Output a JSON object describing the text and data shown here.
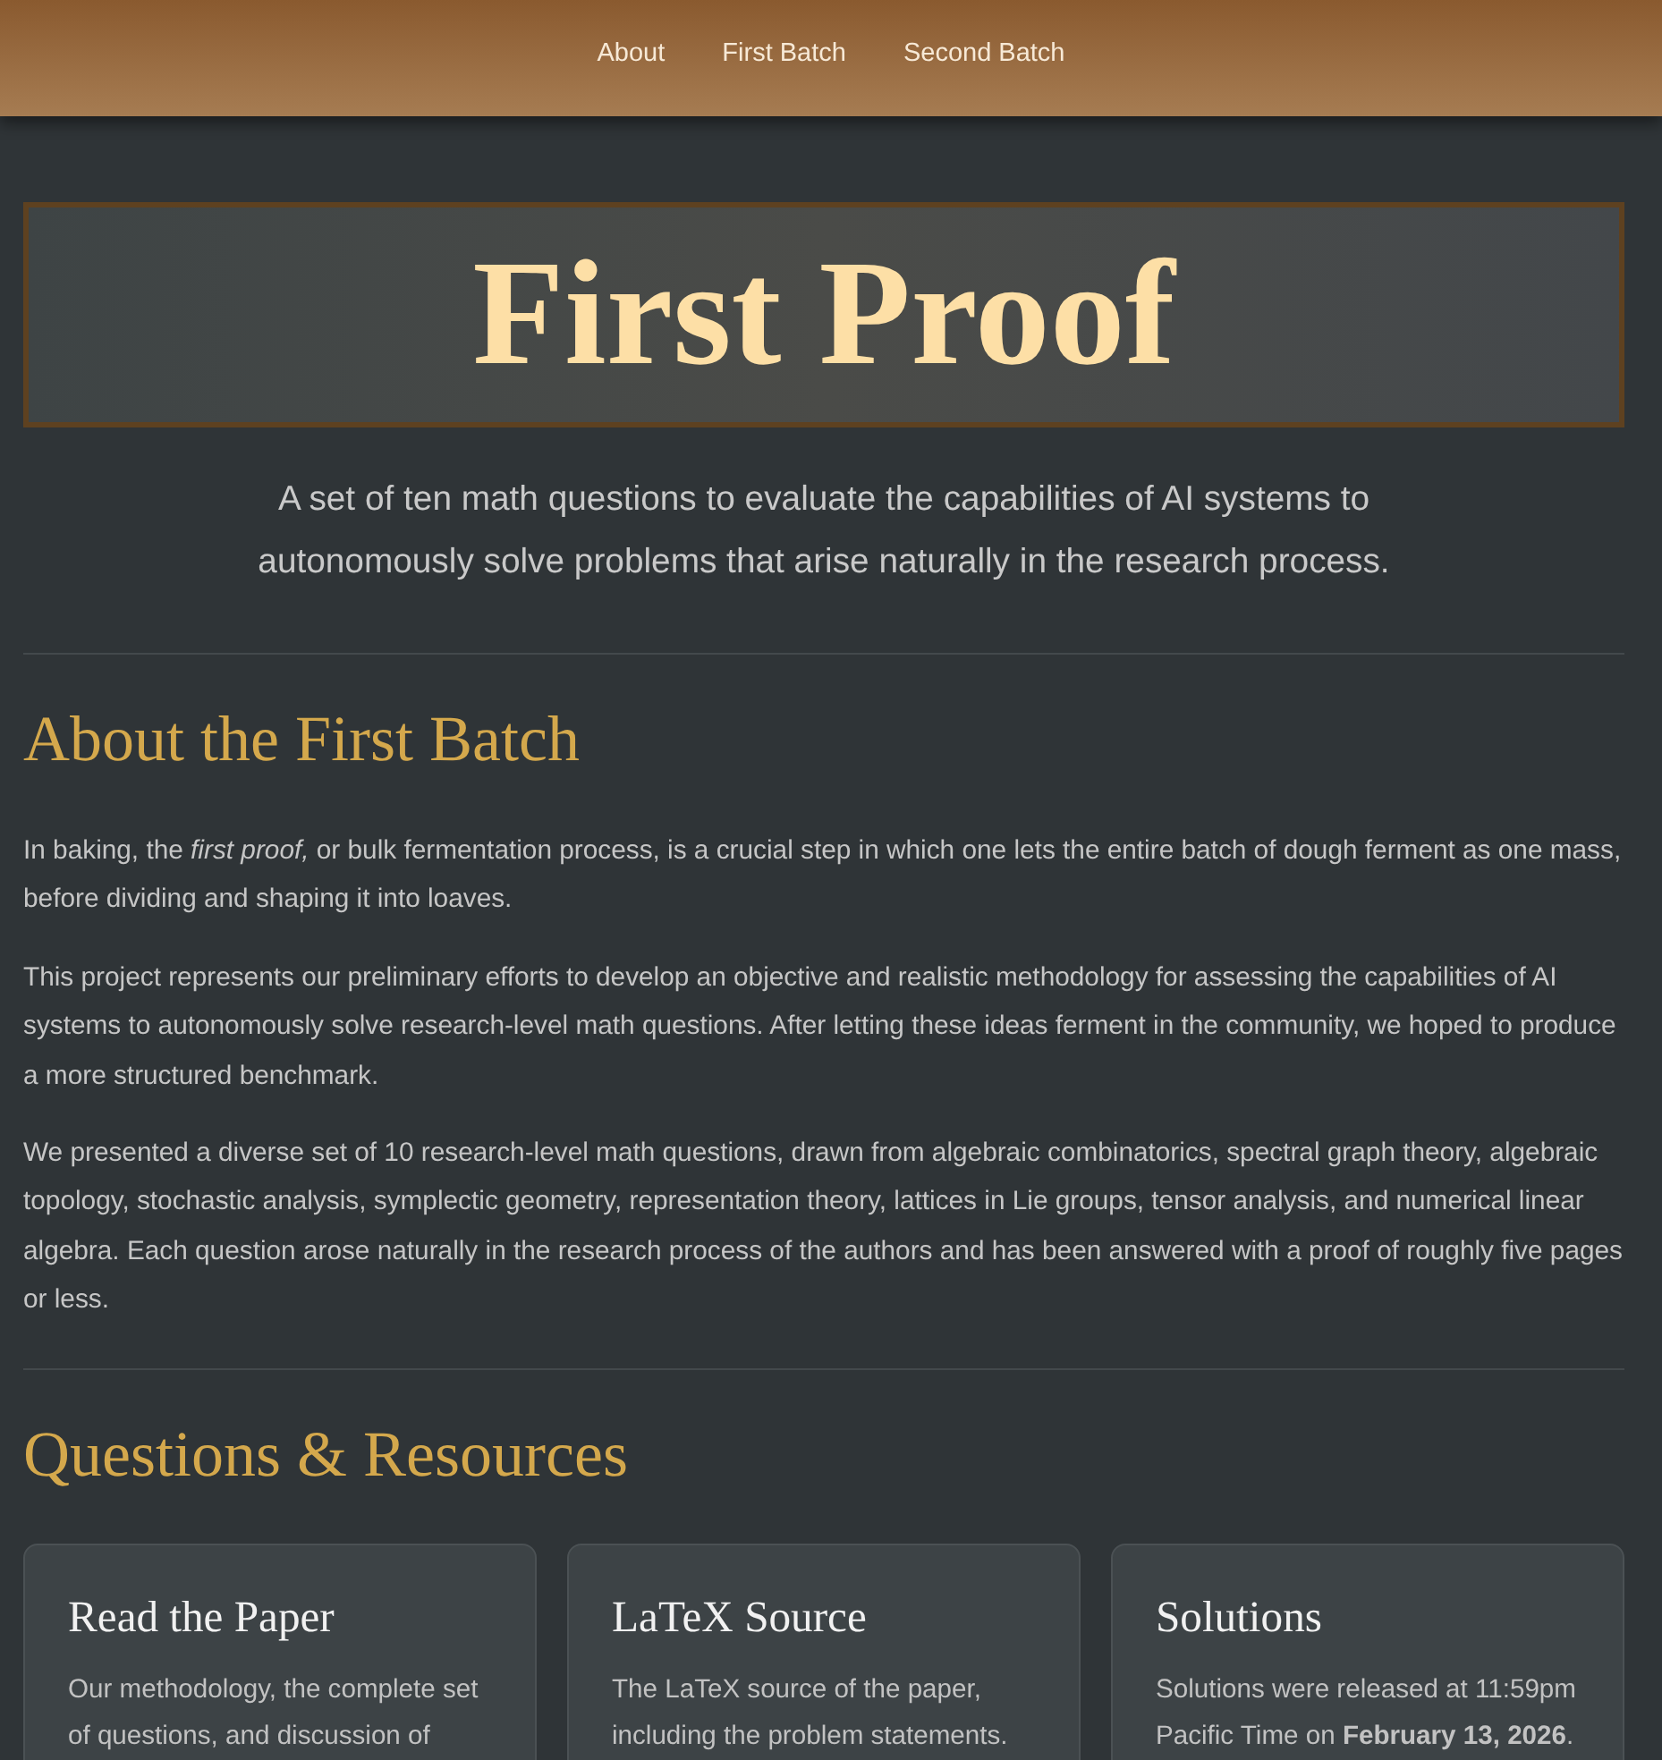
{
  "nav": {
    "links": [
      "About",
      "First Batch",
      "Second Batch"
    ]
  },
  "banner": {
    "title": "First Proof"
  },
  "tagline": "A set of ten math questions to evaluate the capabilities of AI systems to autonomously solve problems that arise naturally in the research process.",
  "sections": [
    {
      "heading": "About the First Batch",
      "paragraphs": [
        "In baking, the *first proof,* or bulk fermentation process, is a crucial step in which one lets the entire batch of dough ferment as one mass, before dividing and shaping it into loaves.",
        "This project represents our preliminary efforts to develop an objective and realistic methodology for assessing the capabilities of AI systems to autonomously solve research-level math questions. After letting these ideas ferment in the community, we hoped to produce a more structured benchmark.",
        "We presented a diverse set of 10 research-level math questions, drawn from algebraic combinatorics, spectral graph theory, algebraic topology, stochastic analysis, symplectic geometry, representation theory, lattices in Lie groups, tensor analysis, and numerical linear algebra. Each question arose naturally in the research process of the authors and has been answered with a proof of roughly five pages or less."
      ]
    },
    {
      "heading": "Questions & Resources",
      "cards": [
        {
          "title": "Read the Paper",
          "text": "Our methodology, the complete set of questions, and discussion of"
        },
        {
          "title": "LaTeX Source",
          "text": "The LaTeX source of the paper, including the problem statements."
        },
        {
          "title": "Solutions",
          "text": "Solutions were released at 11:59pm Pacific Time on **February 13, 2026**."
        }
      ]
    }
  ]
}
